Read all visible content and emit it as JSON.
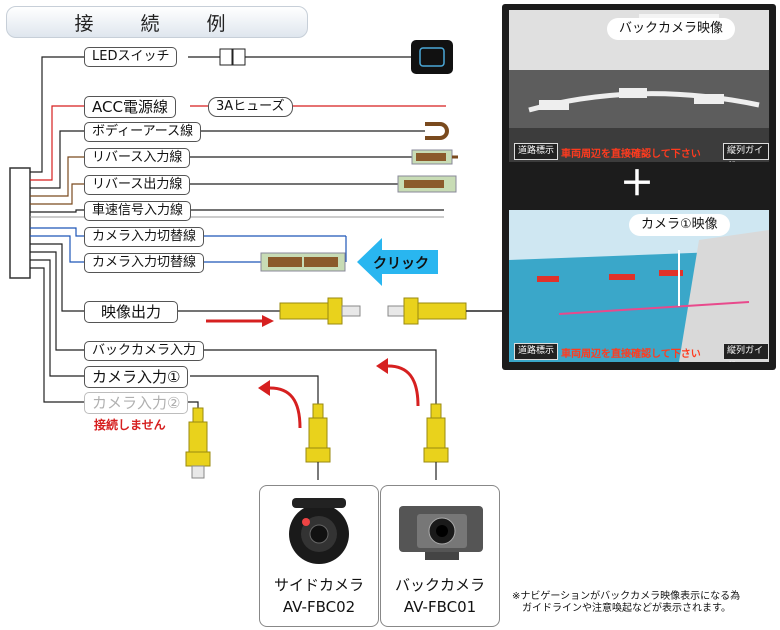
{
  "title": "接　続　例",
  "wires": {
    "led_switch": "LEDスイッチ",
    "acc": "ACC電源線",
    "fuse": "3Aヒューズ",
    "body_earth": "ボディーアース線",
    "reverse_in": "リバース入力線",
    "reverse_out": "リバース出力線",
    "speed_signal": "車速信号入力線",
    "cam_switch_1": "カメラ入力切替線",
    "cam_switch_2": "カメラ入力切替線",
    "video_out": "映像出力",
    "back_cam_in": "バックカメラ入力",
    "cam_in_1": "カメラ入力①",
    "cam_in_2": "カメラ入力②"
  },
  "click_label": "クリック",
  "not_connected": "接続しません",
  "cameras": {
    "side": {
      "name": "サイドカメラ",
      "model": "AV-FBC02"
    },
    "back": {
      "name": "バックカメラ",
      "model": "AV-FBC01"
    }
  },
  "screen": {
    "back_view_title": "バックカメラ映像",
    "plus": "＋",
    "cam1_view_title": "カメラ①映像",
    "road_btn": "道路標示",
    "warning": "車両周辺を直接確認して下さい",
    "guide_btn": "縦列ガイド"
  },
  "footnote": {
    "line1": "※ナビゲーションがバックカメラ映像表示になる為",
    "line2": "ガイドラインや注意喚起などが表示されます。"
  },
  "colors": {
    "acc_wire": "#d61f1f",
    "earth_wire": "#7a4a1e",
    "switch_wire": "#1f56b8",
    "rca_yellow": "#e9d21c",
    "click_arrow": "#29b6f0",
    "arrow_red": "#d62020",
    "led_switch_fill": "#111111"
  }
}
